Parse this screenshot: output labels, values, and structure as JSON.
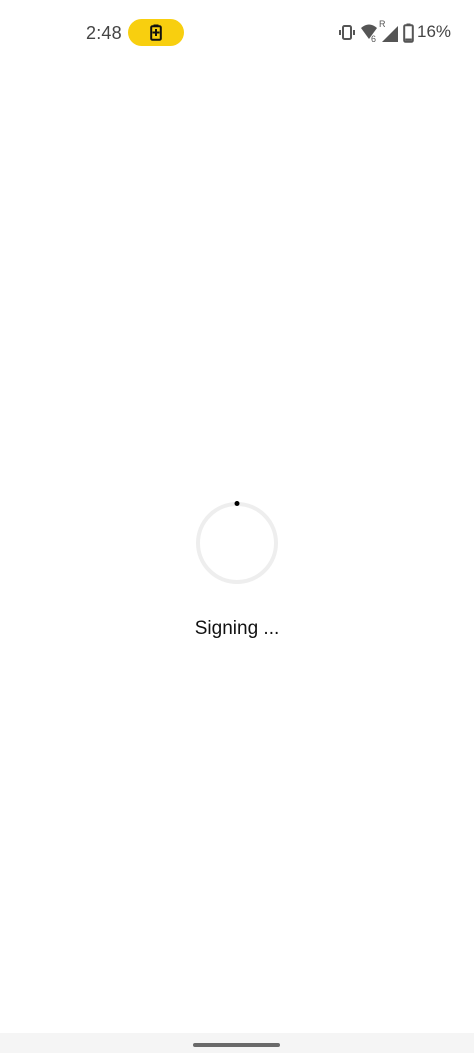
{
  "status_bar": {
    "time": "2:48",
    "battery_percent": "16%",
    "battery_saver_color": "#f8cf0f",
    "roaming_indicator": "R",
    "network_type": "6",
    "icons": [
      "battery-saver-icon",
      "vibrate-icon",
      "wifi-icon",
      "signal-icon",
      "battery-icon"
    ]
  },
  "main": {
    "loading_text": "Signing ...",
    "spinner_track_color": "#eeeeee",
    "spinner_dot_color": "#000000"
  },
  "nav_bar": {
    "handle_color": "#6a6a6a"
  }
}
